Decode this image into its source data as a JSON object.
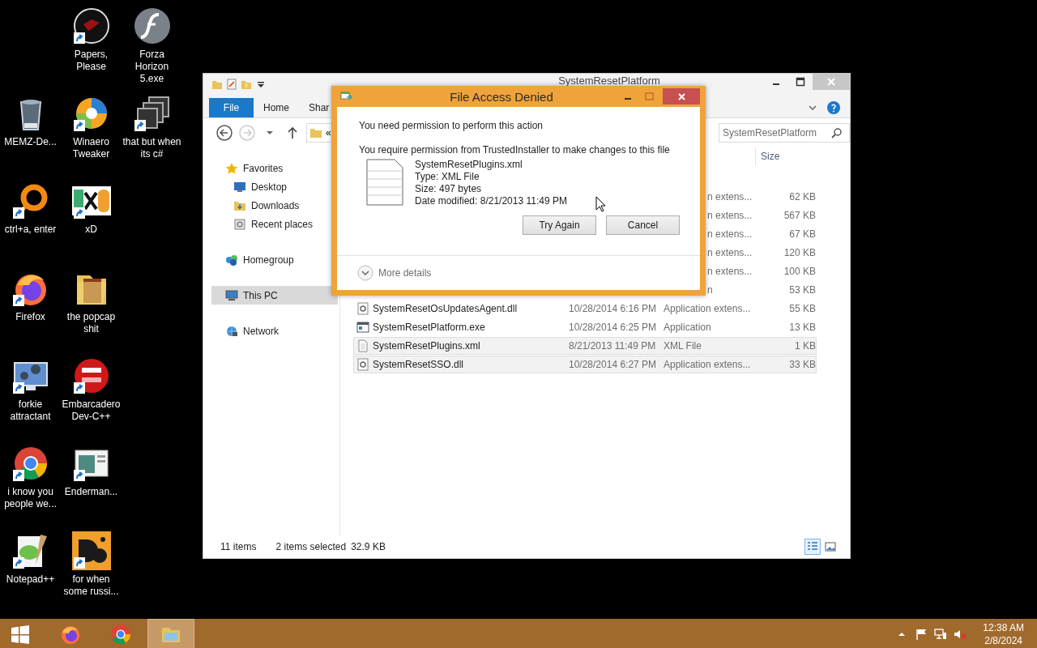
{
  "desktop_icon_columns": [
    {
      "icons": [
        {
          "label": "MEMZ-De...",
          "kind": "recycle-bin",
          "shortcut": false
        },
        {
          "label": "ctrl+a, enter",
          "kind": "ring",
          "shortcut": true
        },
        {
          "label": "Firefox",
          "kind": "firefox",
          "shortcut": true
        },
        {
          "label": "forkie attractant",
          "kind": "monitor",
          "shortcut": true
        },
        {
          "label": "i know you people we...",
          "kind": "chrome",
          "shortcut": true
        },
        {
          "label": "Notepad++",
          "kind": "notepad",
          "shortcut": true
        }
      ]
    },
    {
      "icons": [
        {
          "label": "Papers, Please",
          "kind": "disc",
          "shortcut": true
        },
        {
          "label": "Winaero Tweaker",
          "kind": "swirl",
          "shortcut": true
        },
        {
          "label": "xD",
          "kind": "tile",
          "shortcut": true
        },
        {
          "label": "the popcap shit",
          "kind": "folder",
          "shortcut": false
        },
        {
          "label": "Embarcadero Dev-C++",
          "kind": "red-disc",
          "shortcut": true
        },
        {
          "label": "Enderman...",
          "kind": "window",
          "shortcut": true
        },
        {
          "label": "for when some russi...",
          "kind": "orange-tile",
          "shortcut": true
        }
      ]
    },
    {
      "icons": [
        {
          "label": "Forza Horizon 5.exe",
          "kind": "flash",
          "shortcut": false
        },
        {
          "label": "that but when its c#",
          "kind": "stack",
          "shortcut": true
        }
      ]
    }
  ],
  "explorer": {
    "title": "SystemResetPlatform",
    "ribbon_tabs": [
      {
        "label": "File",
        "kind": "file"
      },
      {
        "label": "Home",
        "kind": "tab"
      },
      {
        "label": "Shar",
        "kind": "tab"
      }
    ],
    "address_overflow": "«",
    "search": {
      "placeholder": "SystemResetPlatform"
    },
    "nav": [
      {
        "label": "Favorites",
        "kind": "star",
        "selected": false,
        "children": [
          {
            "label": "Desktop",
            "kind": "desktop",
            "selected": false
          },
          {
            "label": "Downloads",
            "kind": "downloads",
            "selected": false
          },
          {
            "label": "Recent places",
            "kind": "recent",
            "selected": false
          }
        ]
      },
      {
        "label": "Homegroup",
        "kind": "homegroup",
        "selected": false
      },
      {
        "label": "This PC",
        "kind": "pc",
        "selected": true
      },
      {
        "label": "Network",
        "kind": "network",
        "selected": false
      }
    ],
    "columns": [
      {
        "label": "Size"
      }
    ],
    "rows": [
      {
        "kind": "partial",
        "type": "n extens...",
        "size": "62 KB",
        "selected": false
      },
      {
        "kind": "partial",
        "type": "n extens...",
        "size": "567 KB",
        "selected": false
      },
      {
        "kind": "partial",
        "type": "n extens...",
        "size": "67 KB",
        "selected": false
      },
      {
        "kind": "partial",
        "type": "n extens...",
        "size": "120 KB",
        "selected": false
      },
      {
        "kind": "partial",
        "type": "n extens...",
        "size": "100 KB",
        "selected": false
      },
      {
        "kind": "partial",
        "type": "n",
        "size": "53 KB",
        "selected": false
      },
      {
        "kind": "dll",
        "name": "SystemResetOsUpdatesAgent.dll",
        "date": "10/28/2014 6:16 PM",
        "type": "Application extens...",
        "size": "55 KB",
        "selected": false
      },
      {
        "kind": "exe",
        "name": "SystemResetPlatform.exe",
        "date": "10/28/2014 6:25 PM",
        "type": "Application",
        "size": "13 KB",
        "selected": false
      },
      {
        "kind": "xml",
        "name": "SystemResetPlugins.xml",
        "date": "8/21/2013 11:49 PM",
        "type": "XML File",
        "size": "1 KB",
        "selected": true
      },
      {
        "kind": "dll",
        "name": "SystemResetSSO.dll",
        "date": "10/28/2014 6:27 PM",
        "type": "Application extens...",
        "size": "33 KB",
        "selected": true
      }
    ],
    "status": {
      "count": "11 items",
      "selection": "2 items selected",
      "size": "32.9 KB"
    },
    "views": [
      {
        "kind": "details",
        "selected": true
      },
      {
        "kind": "large-icons",
        "selected": false
      }
    ]
  },
  "dialog": {
    "title": "File Access Denied",
    "heading": "You need permission to perform this action",
    "message": "You require permission from TrustedInstaller to make changes to this file",
    "file": {
      "name": "SystemResetPlugins.xml",
      "type": "Type: XML File",
      "size": "Size: 497 bytes",
      "date": "Date modified: 8/21/2013 11:49 PM"
    },
    "buttons": [
      "Try Again",
      "Cancel"
    ],
    "details": "More details"
  },
  "taskbar": {
    "apps": [
      {
        "kind": "start",
        "active": false
      },
      {
        "kind": "firefox",
        "active": false
      },
      {
        "kind": "chrome",
        "active": false
      },
      {
        "kind": "explorer",
        "active": true
      }
    ],
    "muted": true,
    "time": "12:38 AM",
    "date": "2/8/2024"
  }
}
